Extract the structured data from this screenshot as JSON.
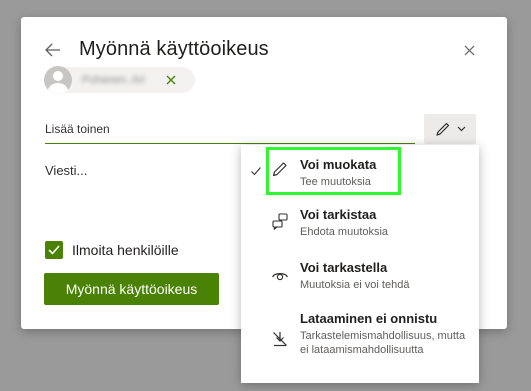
{
  "dialog": {
    "title": "Myönnä käyttöoikeus",
    "person_chip": {
      "name": "Puhanen, Ari"
    },
    "add_input": {
      "placeholder": "Lisää toinen"
    },
    "message": {
      "placeholder": "Viesti..."
    },
    "notify": {
      "label": "Ilmoita henkilöille",
      "checked": true
    },
    "grant_button": {
      "label": "Myönnä käyttöoikeus"
    }
  },
  "permission_menu": {
    "items": [
      {
        "icon": "pencil-icon",
        "label": "Voi muokata",
        "description": "Tee muutoksia",
        "selected": true
      },
      {
        "icon": "suggest-icon",
        "label": "Voi tarkistaa",
        "description": "Ehdota muutoksia",
        "selected": false
      },
      {
        "icon": "eye-icon",
        "label": "Voi tarkastella",
        "description": "Muutoksia ei voi tehdä",
        "selected": false
      },
      {
        "icon": "no-download-icon",
        "label": "Lataaminen ei onnistu",
        "description": "Tarkastelemismahdollisuus, mutta ei lataamismahdollisuutta",
        "selected": false
      }
    ]
  },
  "colors": {
    "accent_green": "#498205",
    "highlight_green": "#2ff82f",
    "overlay": "#9a9a9a"
  }
}
